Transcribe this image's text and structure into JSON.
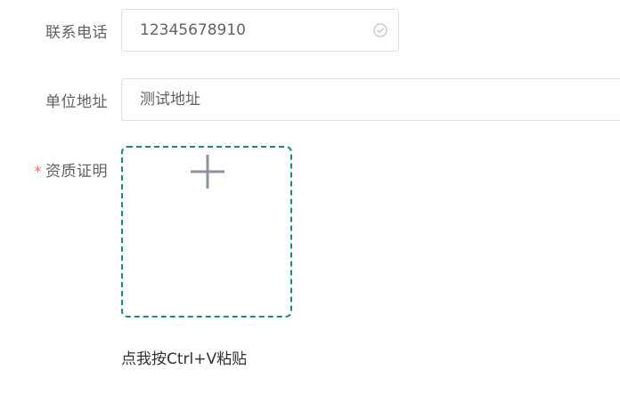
{
  "form": {
    "phone": {
      "label": "联系电话",
      "value": "12345678910",
      "status_icon": "check-circle-icon"
    },
    "address": {
      "label": "单位地址",
      "value": "测试地址"
    },
    "certificate": {
      "required_mark": "*",
      "label": "资质证明",
      "upload_icon": "plus-icon",
      "paste_hint": "点我按Ctrl+V粘贴"
    }
  },
  "colors": {
    "label_text": "#5f6066",
    "input_border": "#dcdfe6",
    "required": "#f56c6c",
    "upload_border": "#1d8a80",
    "icon_gray": "#8c939d"
  }
}
